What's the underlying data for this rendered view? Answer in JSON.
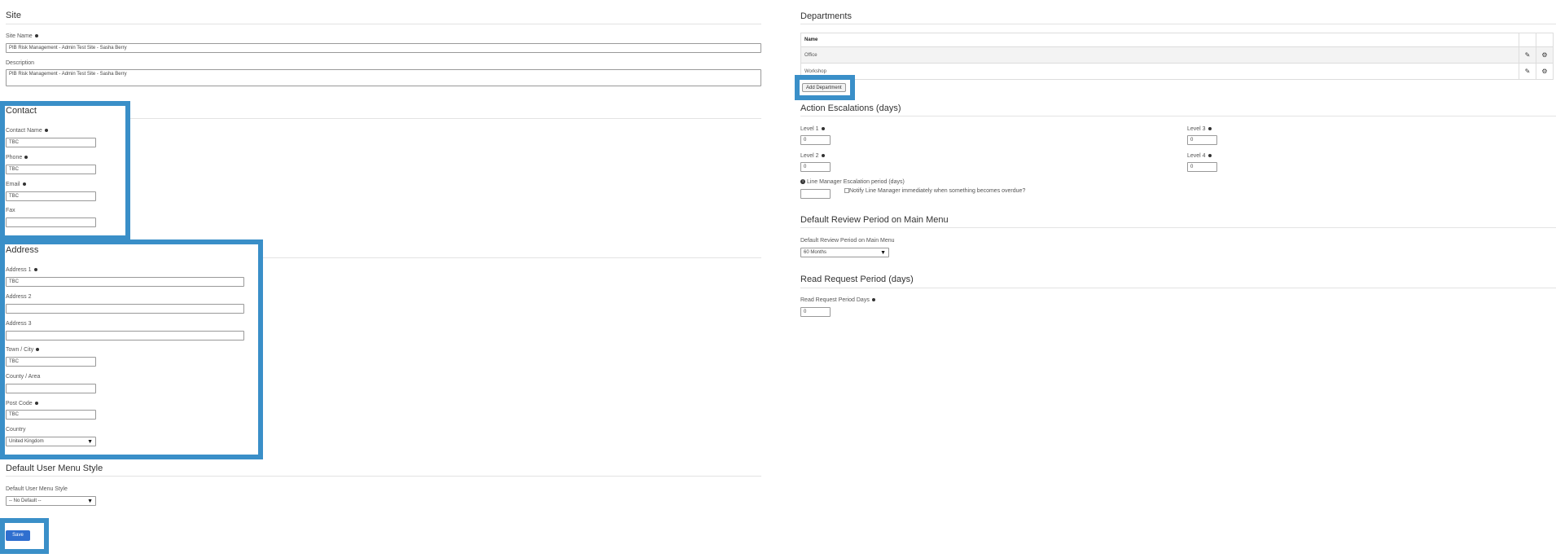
{
  "site": {
    "heading": "Site",
    "name_label": "Site Name",
    "name_value": "PIB Risk Management - Admin Test Site - Sasha Berry",
    "description_label": "Description",
    "description_value": "PIB Risk Management - Admin Test Site - Sasha Berry"
  },
  "contact": {
    "heading": "Contact",
    "name_label": "Contact Name",
    "name_value": "TBC",
    "phone_label": "Phone",
    "phone_value": "TBC",
    "email_label": "Email",
    "email_value": "TBC",
    "fax_label": "Fax",
    "fax_value": ""
  },
  "address": {
    "heading": "Address",
    "address1_label": "Address 1",
    "address1_value": "TBC",
    "address2_label": "Address 2",
    "address2_value": "",
    "address3_label": "Address 3",
    "address3_value": "",
    "town_label": "Town / City",
    "town_value": "TBC",
    "county_label": "County / Area",
    "county_value": "",
    "postcode_label": "Post Code",
    "postcode_value": "TBC",
    "country_label": "Country",
    "country_value": "United Kingdom"
  },
  "menu_style": {
    "heading": "Default User Menu Style",
    "label": "Default User Menu Style",
    "value": "-- No Default --"
  },
  "save_label": "Save",
  "departments": {
    "heading": "Departments",
    "column_name": "Name",
    "rows": [
      "Office",
      "Workshop"
    ],
    "add_label": "Add Department"
  },
  "escalations": {
    "heading": "Action Escalations (days)",
    "level1_label": "Level 1",
    "level1_value": "0",
    "level2_label": "Level 2",
    "level2_value": "0",
    "level3_label": "Level 3",
    "level3_value": "0",
    "level4_label": "Level 4",
    "level4_value": "0",
    "line_manager_label": "Line Manager Escalation period (days)",
    "line_manager_value": "",
    "notify_label": "Notify Line Manager immediately when something becomes overdue?"
  },
  "review": {
    "heading": "Default Review Period on Main Menu",
    "label": "Default Review Period on Main Menu",
    "value": "60 Months"
  },
  "read_request": {
    "heading": "Read Request Period (days)",
    "label": "Read Request Period Days",
    "value": "0"
  },
  "colors": {
    "highlight": "#3a8fc8",
    "save_button": "#2f6fcf"
  },
  "icons": {
    "required": "required-dot-icon",
    "edit": "pencil-icon",
    "settings": "gear-icon",
    "info": "info-icon",
    "dropdown": "caret-down-icon"
  }
}
